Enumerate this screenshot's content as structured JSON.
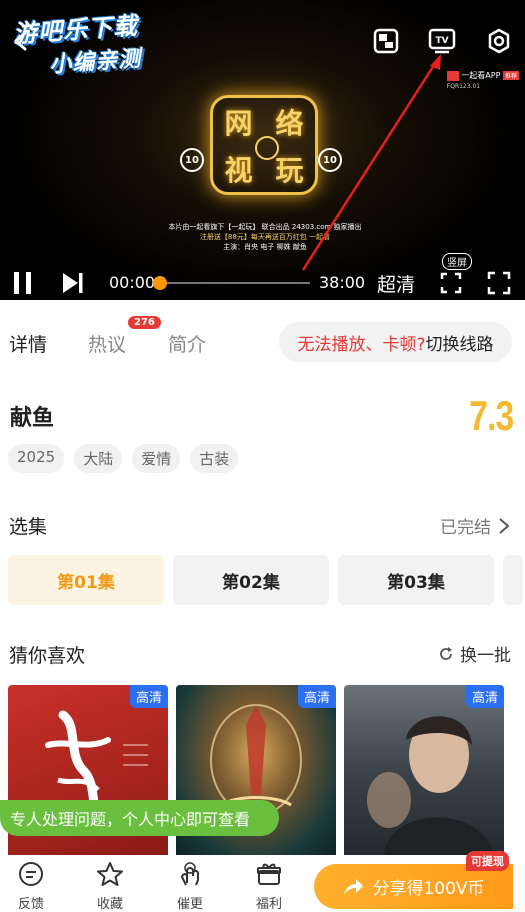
{
  "watermark": {
    "line1": "游吧乐下载",
    "line2": "小编亲测"
  },
  "video": {
    "logo_chars": [
      "网",
      "络",
      "视",
      "玩"
    ],
    "skip_back": "10",
    "skip_forward": "10",
    "caption_line1": "本片由一起看旗下【一起玩】 联合出品 24303.com 独家播出",
    "caption_line2": "注册送【88元】每天再送百万红包 一起看",
    "caption_line3": "主演：肖央 电子 柳姝 献鱼",
    "corner_ad_title": "一起看APP",
    "corner_ad_tag": "推荐",
    "corner_ad_sub": "FQR123.01"
  },
  "controls": {
    "current_time": "00:00",
    "total_time": "38:00",
    "progress": 0,
    "quality": "超清",
    "vertical_label": "竖屏"
  },
  "tabs": {
    "items": [
      "详情",
      "热议",
      "简介"
    ],
    "hot_count": "276",
    "switch_problem": "无法播放、卡顿?",
    "switch_action": "切换线路"
  },
  "show": {
    "title": "献鱼",
    "score": "7.3",
    "tags": [
      "2025",
      "大陆",
      "爱情",
      "古装"
    ]
  },
  "episodes": {
    "title": "选集",
    "status": "已完结",
    "items": [
      "第01集",
      "第02集",
      "第03集"
    ]
  },
  "recommend": {
    "title": "猜你喜欢",
    "refresh": "换一批",
    "badges": [
      "高清",
      "高清",
      "高清"
    ]
  },
  "toast": "专人处理问题，个人中心即可查看",
  "bottom_nav": {
    "items": [
      "反馈",
      "收藏",
      "催更",
      "福利"
    ],
    "share": "分享得100V币",
    "cash_badge": "可提现"
  },
  "colors": {
    "accent": "#f29a12",
    "red": "#e53935",
    "blue_badge": "#2b6ef0",
    "green_toast": "#6abf3e",
    "score": "#f5b82e"
  }
}
